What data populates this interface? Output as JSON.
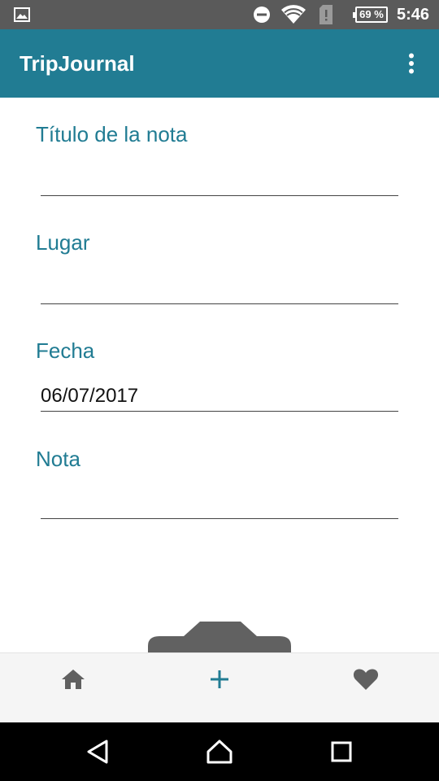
{
  "status_bar": {
    "time": "5:46",
    "battery": "69 %",
    "icons": [
      "image-notification-icon",
      "do-not-disturb-icon",
      "wifi-icon",
      "sim-alert-icon",
      "battery-icon"
    ]
  },
  "app_bar": {
    "title": "TripJournal",
    "menu_icon": "more-vert-icon"
  },
  "form": {
    "title_field": {
      "label": "Título de la nota",
      "value": ""
    },
    "place_field": {
      "label": "Lugar",
      "value": ""
    },
    "date_field": {
      "label": "Fecha",
      "value": "06/07/2017"
    },
    "note_field": {
      "label": "Nota",
      "value": ""
    }
  },
  "bottom_nav": {
    "items": [
      {
        "icon": "home-icon"
      },
      {
        "icon": "add-icon"
      },
      {
        "icon": "favorite-icon"
      }
    ],
    "active_color": "#217c93",
    "inactive_color": "#606060"
  },
  "system_nav": {
    "icons": [
      "back-icon",
      "home-icon",
      "recents-icon"
    ]
  },
  "colors": {
    "accent": "#217c93",
    "status_bar": "#5a5a5a"
  }
}
